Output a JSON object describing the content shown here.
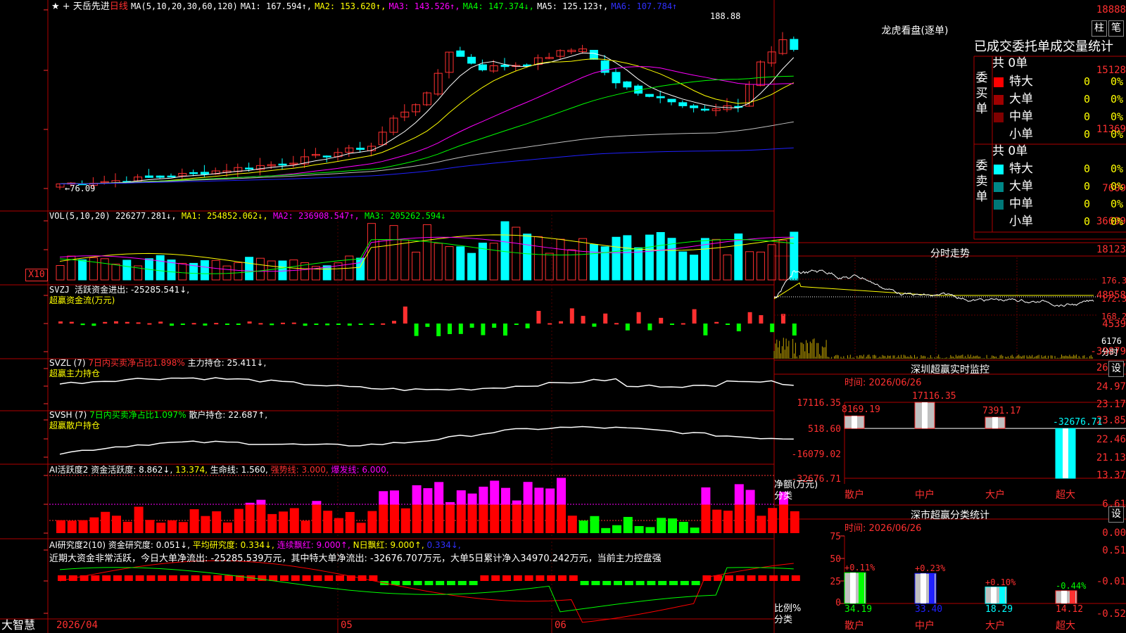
{
  "stock": {
    "star": "★",
    "plus": "+",
    "name": "天岳先进",
    "period": "日线"
  },
  "kline": {
    "ma_label": "MA(5,10,20,30,60,120)",
    "ma1": "MA1: 167.594↑,",
    "ma2": "MA2: 153.620↑,",
    "ma3": "MA3: 143.526↑,",
    "ma4": "MA4: 147.374↓,",
    "ma5": "MA5: 125.123↑,",
    "ma6": "MA6: 107.784↑",
    "yticks": [
      "18888",
      "15128",
      "11369",
      "7609"
    ],
    "high_label": "188.88",
    "low_label": "←76.09",
    "ma_colors": [
      "#ffffff",
      "#ffff00",
      "#ff00ff",
      "#00ff00",
      "#c0c0c0",
      "#2020ff"
    ]
  },
  "volume": {
    "label": "VOL(5,10,20)",
    "v": "226277.281↓,",
    "ma1": "MA1: 254852.062↓,",
    "ma2": "MA2: 236908.547↑,",
    "ma3": "MA3: 205262.594↓",
    "yticks": [
      "36699",
      "18123"
    ],
    "unit": "X10"
  },
  "svzj": {
    "label": "SVZJ",
    "text": "活跃资金进出: -25285.541↓,",
    "sub": "超赢资金流(万元)",
    "yticks": [
      "48958",
      "4539",
      "-39879"
    ]
  },
  "svzl": {
    "label": "SVZL (7)",
    "ratio": "7日内买卖净占比1.898%",
    "hold": "主力持仓: 25.411↓,",
    "sub": "超赢主力持仓",
    "yticks": [
      "26.77",
      "24.97",
      "23.17"
    ]
  },
  "svsh": {
    "label": "SVSH (7)",
    "ratio": "7日内买卖净占比1.097%",
    "hold": "散户持仓: 22.687↑,",
    "sub": "超赢散户持仓",
    "yticks": [
      "23.85",
      "22.46",
      "21.13"
    ]
  },
  "ai_active": {
    "label": "AI活跃度2",
    "t1": "资金活跃度: 8.862↓,",
    "t2": "13.374,",
    "t3": "生命线: 1.560,",
    "t4": "强势线: 3.000,",
    "t5": "爆发线: 6.000,",
    "yticks": [
      "13.37",
      "6.61",
      "0.00"
    ]
  },
  "ai_research": {
    "label": "AI研究度2(10)",
    "t1": "资金研究度: 0.051↓,",
    "t2": "平均研究度: 0.334↓,",
    "t3": "连续飘红: 9.000↑,",
    "t4": "N日飘红: 9.000↑,",
    "t5": "0.334↓,",
    "comment": "近期大资金非常活跃，今日大单净流出: -25285.539万元，其中特大单净流出: -32676.707万元，大单5日累计净入34970.242万元，当前主力控盘强",
    "yticks": [
      "0.51",
      "-0.01",
      "-0.52"
    ]
  },
  "xaxis": {
    "start": "2026/04",
    "m1": "05",
    "m2": "06",
    "brand": "大智慧"
  },
  "dragon": {
    "title": "龙虎看盘(逐单)",
    "btn1": "柱",
    "btn2": "笔",
    "header": "已成交委托单成交量统计",
    "buy": {
      "side": "委买单",
      "total": "共 0单",
      "rows": [
        {
          "name": "特大",
          "n": "0",
          "p": "0%",
          "color": "#ff0000"
        },
        {
          "name": "大单",
          "n": "0",
          "p": "0%",
          "color": "#a00000"
        },
        {
          "name": "中单",
          "n": "0",
          "p": "0%",
          "color": "#800000"
        },
        {
          "name": "小单",
          "n": "0",
          "p": "0%",
          "color": "#000000"
        }
      ]
    },
    "sell": {
      "side": "委卖单",
      "total": "共 0单",
      "rows": [
        {
          "name": "特大",
          "n": "0",
          "p": "0%",
          "color": "#00ffff"
        },
        {
          "name": "大单",
          "n": "0",
          "p": "0%",
          "color": "#008888"
        },
        {
          "name": "中单",
          "n": "0",
          "p": "0%",
          "color": "#007777"
        },
        {
          "name": "小单",
          "n": "0",
          "p": "0%",
          "color": "#000000"
        }
      ]
    }
  },
  "intraday": {
    "title": "分时走势",
    "yticks": [
      "176.3",
      "172.3",
      "168.2",
      "6176"
    ],
    "unit": "分时"
  },
  "monitor": {
    "title": "深圳超赢实时监控",
    "btn": "设",
    "time": "时间: 2026/06/26",
    "yticks": [
      "17116.35",
      "518.60",
      "-16079.02",
      "-32676.71"
    ],
    "ylabel": "净额(万元)",
    "xlabel": "分类",
    "bars": [
      {
        "cat": "散户",
        "value": 8169.19,
        "label": "8169.19"
      },
      {
        "cat": "中户",
        "value": 17116.35,
        "label": "17116.35"
      },
      {
        "cat": "大户",
        "value": 7391.17,
        "label": "7391.17"
      },
      {
        "cat": "超大",
        "value": -32676.71,
        "label": "-32676.71"
      }
    ]
  },
  "category": {
    "title": "深市超赢分类统计",
    "btn": "设",
    "time": "时间: 2026/06/26",
    "yticks": [
      "75",
      "50",
      "25",
      "0"
    ],
    "ylabel": "比例%",
    "xlabel": "分类",
    "bars": [
      {
        "cat": "散户",
        "value": 34.19,
        "label": "34.19",
        "change": "+0.11%",
        "color": "#00ff00"
      },
      {
        "cat": "中户",
        "value": 33.4,
        "label": "33.40",
        "change": "+0.23%",
        "color": "#2020ff"
      },
      {
        "cat": "大户",
        "value": 18.29,
        "label": "18.29",
        "change": "+0.10%",
        "color": "#00ffff"
      },
      {
        "cat": "超大",
        "value": 14.12,
        "label": "14.12",
        "change": "-0.44%",
        "color": "#ff3030"
      }
    ]
  }
}
